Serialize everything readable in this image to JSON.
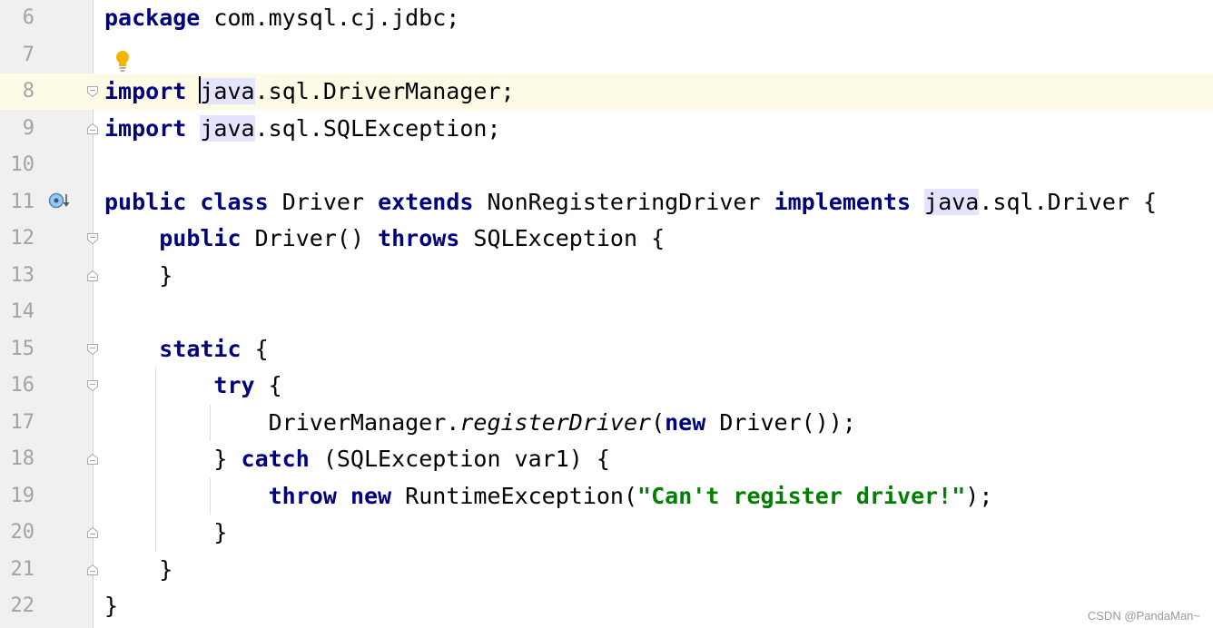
{
  "editor": {
    "lines": [
      {
        "num": "6",
        "tokens": [
          {
            "t": "package",
            "c": "kw"
          },
          {
            "t": " com.mysql.cj.jdbc;"
          }
        ]
      },
      {
        "num": "7",
        "tokens": []
      },
      {
        "num": "8",
        "current": true,
        "tokens": [
          {
            "t": "import",
            "c": "kw"
          },
          {
            "t": " "
          },
          {
            "t": "java",
            "c": "pk"
          },
          {
            "t": ".sql.DriverManager;"
          }
        ]
      },
      {
        "num": "9",
        "tokens": [
          {
            "t": "import",
            "c": "kw"
          },
          {
            "t": " "
          },
          {
            "t": "java",
            "c": "pk"
          },
          {
            "t": ".sql.SQLException;"
          }
        ]
      },
      {
        "num": "10",
        "tokens": []
      },
      {
        "num": "11",
        "tokens": [
          {
            "t": "public",
            "c": "kw"
          },
          {
            "t": " "
          },
          {
            "t": "class",
            "c": "kw"
          },
          {
            "t": " Driver "
          },
          {
            "t": "extends",
            "c": "kw"
          },
          {
            "t": " NonRegisteringDriver "
          },
          {
            "t": "implements",
            "c": "kw"
          },
          {
            "t": " "
          },
          {
            "t": "java",
            "c": "pk"
          },
          {
            "t": ".sql.Driver {"
          }
        ]
      },
      {
        "num": "12",
        "tokens": [
          {
            "t": "    "
          },
          {
            "t": "public",
            "c": "kw"
          },
          {
            "t": " Driver() "
          },
          {
            "t": "throws",
            "c": "kw"
          },
          {
            "t": " SQLException {"
          }
        ]
      },
      {
        "num": "13",
        "tokens": [
          {
            "t": "    }"
          }
        ]
      },
      {
        "num": "14",
        "tokens": []
      },
      {
        "num": "15",
        "tokens": [
          {
            "t": "    "
          },
          {
            "t": "static",
            "c": "kw"
          },
          {
            "t": " {"
          }
        ]
      },
      {
        "num": "16",
        "tokens": [
          {
            "t": "        "
          },
          {
            "t": "try",
            "c": "kw"
          },
          {
            "t": " {"
          }
        ]
      },
      {
        "num": "17",
        "tokens": [
          {
            "t": "            DriverManager."
          },
          {
            "t": "registerDriver",
            "c": "it"
          },
          {
            "t": "("
          },
          {
            "t": "new",
            "c": "kw"
          },
          {
            "t": " Driver());"
          }
        ]
      },
      {
        "num": "18",
        "tokens": [
          {
            "t": "        } "
          },
          {
            "t": "catch",
            "c": "kw"
          },
          {
            "t": " (SQLException var1) {"
          }
        ]
      },
      {
        "num": "19",
        "tokens": [
          {
            "t": "            "
          },
          {
            "t": "throw",
            "c": "kw"
          },
          {
            "t": " "
          },
          {
            "t": "new",
            "c": "kw"
          },
          {
            "t": " RuntimeException("
          },
          {
            "t": "\"Can't register driver!\"",
            "c": "str"
          },
          {
            "t": ");"
          }
        ]
      },
      {
        "num": "20",
        "tokens": [
          {
            "t": "        }"
          }
        ]
      },
      {
        "num": "21",
        "tokens": [
          {
            "t": "    }"
          }
        ]
      },
      {
        "num": "22",
        "tokens": [
          {
            "t": "}"
          }
        ]
      }
    ]
  },
  "gutter": {
    "fold_markers": [
      {
        "line": "8",
        "kind": "open"
      },
      {
        "line": "9",
        "kind": "close"
      },
      {
        "line": "12",
        "kind": "open"
      },
      {
        "line": "13",
        "kind": "close"
      },
      {
        "line": "15",
        "kind": "open"
      },
      {
        "line": "16",
        "kind": "open"
      },
      {
        "line": "18",
        "kind": "close"
      },
      {
        "line": "20",
        "kind": "close"
      },
      {
        "line": "21",
        "kind": "close"
      }
    ],
    "icons": [
      "intention-bulb-icon",
      "implements-gutter-icon"
    ]
  },
  "colors": {
    "keyword": "#000080",
    "string": "#008000",
    "package_highlight": "#e4e4ff",
    "current_line": "#fdfbe6",
    "gutter_bg": "#f0f0f0",
    "line_number": "#a3a3a3"
  },
  "watermark": "CSDN @PandaMan~"
}
